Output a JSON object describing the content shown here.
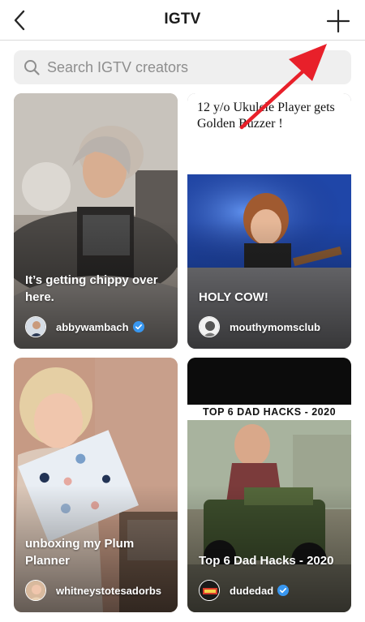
{
  "header": {
    "title": "IGTV",
    "back_icon": "chevron-left-icon",
    "add_icon": "plus-icon"
  },
  "search": {
    "placeholder": "Search IGTV creators",
    "icon": "search-icon"
  },
  "cards": [
    {
      "caption": "It’s getting chippy over here.",
      "creator": "abbywambach",
      "verified": true
    },
    {
      "thumbnail_text": "12 y/o Ukulele Player gets Golden Buzzer !",
      "caption": "HOLY COW!",
      "creator": "mouthymomsclub",
      "verified": false
    },
    {
      "caption": "unboxing my Plum Planner",
      "creator": "whitneystotesadorbs",
      "verified": false
    },
    {
      "thumbnail_text": "TOP 6 DAD HACKS - 2020",
      "caption": "Top 6 Dad Hacks - 2020",
      "creator": "dudedad",
      "verified": true
    }
  ],
  "colors": {
    "annotation_arrow": "#e8202a",
    "verified_badge": "#3897f0",
    "search_bg": "#efefef"
  }
}
